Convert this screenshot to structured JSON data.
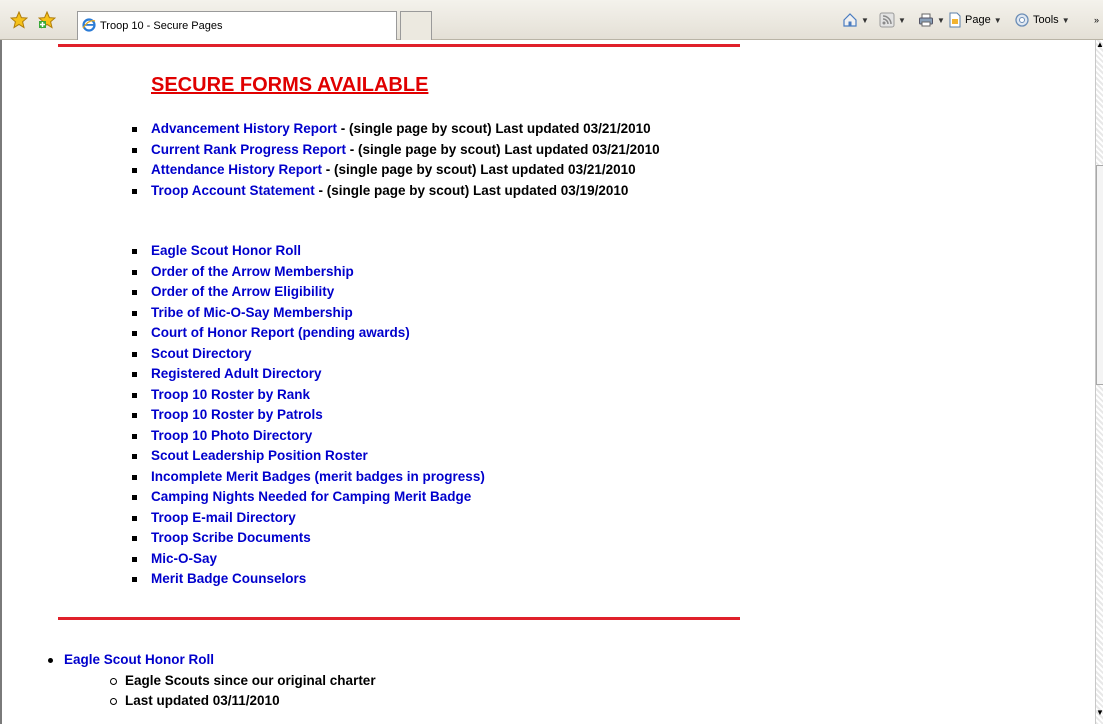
{
  "browser": {
    "tab_title": "Troop 10 - Secure Pages",
    "commands": {
      "page_label": "Page",
      "tools_label": "Tools"
    }
  },
  "page": {
    "heading": "SECURE FORMS AVAILABLE",
    "reports": [
      {
        "link": "Advancement History Report",
        "desc": " - (single page by scout) Last updated 03/21/2010"
      },
      {
        "link": "Current Rank Progress Report",
        "desc": " - (single page by scout) Last updated 03/21/2010"
      },
      {
        "link": "Attendance History Report",
        "desc": " - (single page by scout) Last updated 03/21/2010"
      },
      {
        "link": "Troop Account Statement",
        "desc": " - (single page by scout) Last updated 03/19/2010"
      }
    ],
    "links": [
      "Eagle Scout Honor Roll",
      "Order of the Arrow Membership",
      "Order of the Arrow Eligibility",
      "Tribe of Mic-O-Say Membership",
      "Court of Honor Report (pending awards)",
      "Scout Directory",
      "Registered Adult Directory",
      "Troop 10 Roster by Rank",
      "Troop 10 Roster by Patrols",
      "Troop 10 Photo Directory",
      "Scout Leadership Position Roster",
      "Incomplete Merit Badges (merit badges in progress)",
      "Camping Nights Needed for Camping Merit Badge",
      "Troop E-mail Directory",
      "Troop Scribe Documents",
      "Mic-O-Say",
      "Merit Badge Counselors"
    ],
    "section": {
      "title": "Eagle Scout Honor Roll",
      "items": [
        "Eagle Scouts since our original charter",
        "Last updated 03/11/2010"
      ]
    }
  },
  "colors": {
    "link": "#0000cc",
    "heading": "#e00000",
    "rule": "#e0202a"
  }
}
